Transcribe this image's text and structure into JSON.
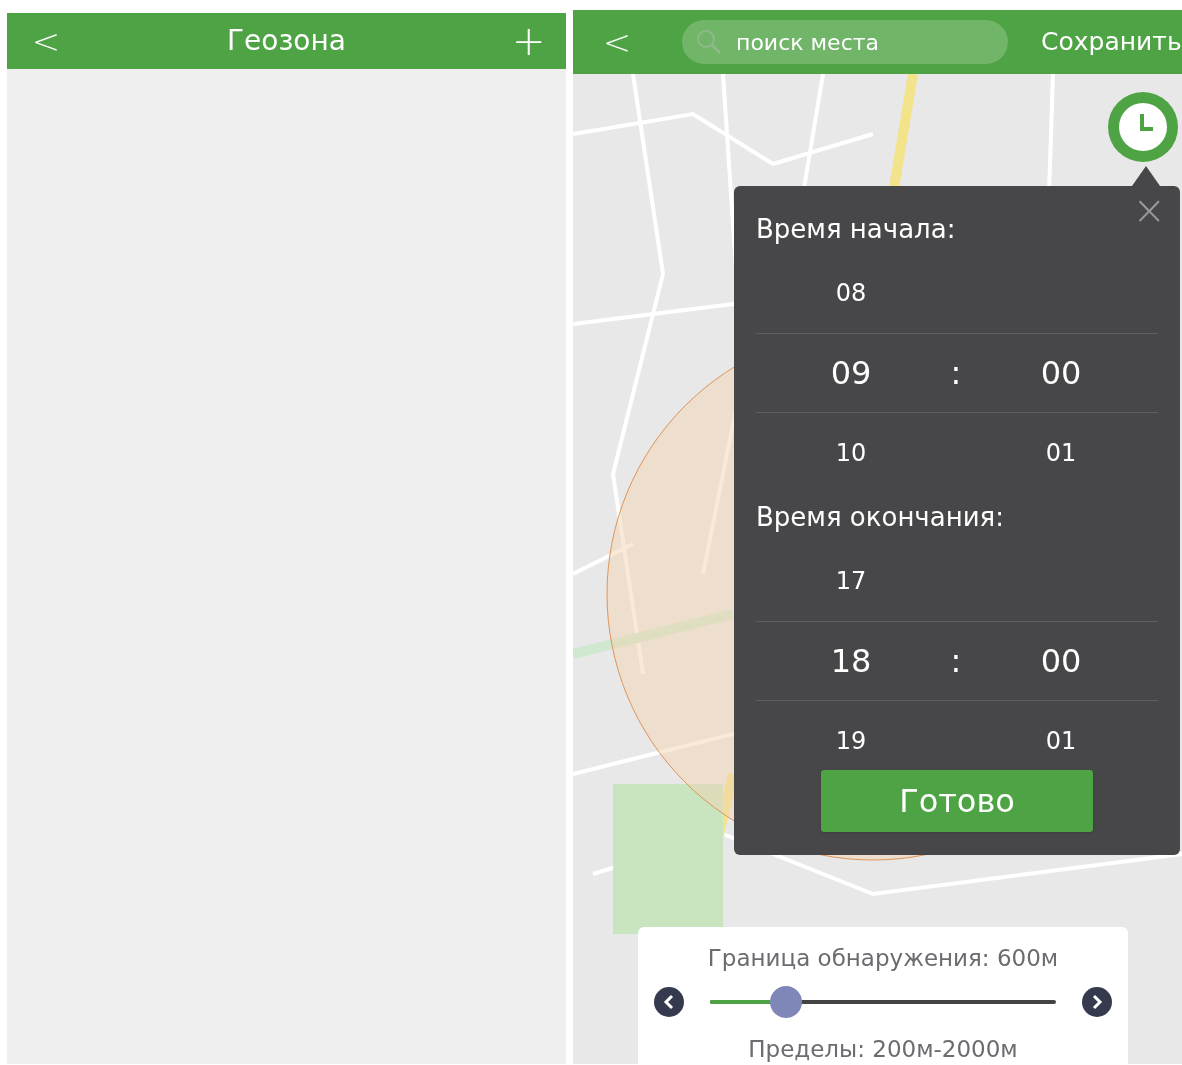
{
  "left_screen": {
    "header": {
      "back": "<",
      "title": "Геозона",
      "add": "+"
    }
  },
  "right_screen": {
    "header": {
      "back": "<",
      "search": {
        "placeholder": "поиск места"
      },
      "save": "Сохранить"
    },
    "time_popup": {
      "close": "×",
      "pickers": [
        {
          "title": "Время начала:",
          "rows": [
            {
              "hour": "08",
              "selected": false
            },
            {
              "hour": "09",
              "separator": ":",
              "minute": "00",
              "selected": true
            },
            {
              "hour": "10",
              "minute": "01",
              "selected": false
            }
          ]
        },
        {
          "title": "Время окончания:",
          "rows": [
            {
              "hour": "17",
              "selected": false
            },
            {
              "hour": "18",
              "separator": ":",
              "minute": "00",
              "selected": true
            },
            {
              "hour": "19",
              "minute": "01",
              "selected": false
            }
          ]
        }
      ],
      "done": "Готово"
    },
    "range_panel": {
      "title": "Граница обнаружения: 600м",
      "slider": {
        "level": 0.22
      },
      "limits": "Пределы: 200м-2000м"
    }
  }
}
